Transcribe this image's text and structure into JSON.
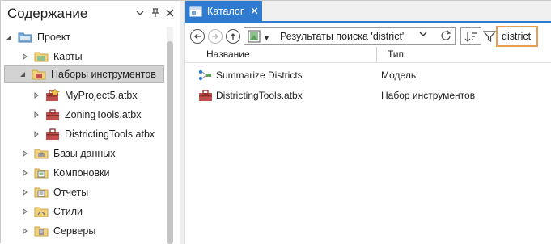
{
  "contents": {
    "title": "Содержание",
    "tree": [
      {
        "label": "Проект",
        "icon": "project-folder-icon",
        "expanded": true
      },
      {
        "label": "Карты",
        "icon": "maps-folder-icon",
        "expanded": false
      },
      {
        "label": "Наборы инструментов",
        "icon": "toolboxes-folder-icon",
        "expanded": true,
        "selected": true
      },
      {
        "label": "MyProject5.atbx",
        "icon": "toolbox-default-icon",
        "expanded": false
      },
      {
        "label": "ZoningTools.atbx",
        "icon": "toolbox-icon",
        "expanded": false
      },
      {
        "label": "DistrictingTools.atbx",
        "icon": "toolbox-icon",
        "expanded": false
      },
      {
        "label": "Базы данных",
        "icon": "databases-folder-icon",
        "expanded": false
      },
      {
        "label": "Компоновки",
        "icon": "layouts-folder-icon",
        "expanded": false
      },
      {
        "label": "Отчеты",
        "icon": "reports-folder-icon",
        "expanded": false
      },
      {
        "label": "Стили",
        "icon": "styles-folder-icon",
        "expanded": false
      },
      {
        "label": "Серверы",
        "icon": "servers-folder-icon",
        "expanded": false
      }
    ]
  },
  "catalog": {
    "tab_label": "Каталог",
    "location": "Результаты поиска 'district'",
    "search_value": "district",
    "columns": {
      "name": "Название",
      "type": "Тип"
    },
    "results": [
      {
        "name": "Summarize Districts",
        "type": "Модель",
        "icon": "model-icon"
      },
      {
        "name": "DistrictingTools.atbx",
        "type": "Набор инструментов",
        "icon": "toolbox-icon"
      }
    ]
  },
  "colors": {
    "accent": "#2e7bcf",
    "search_highlight": "#e8a050",
    "selected_row": "#d3d3d3",
    "toolbox_red": "#c0504d"
  }
}
